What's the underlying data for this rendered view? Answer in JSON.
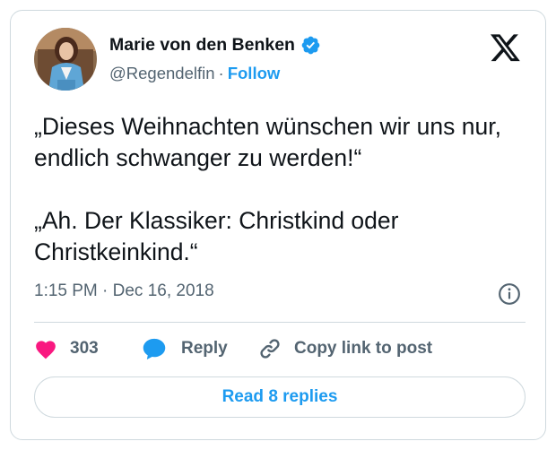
{
  "author": {
    "display_name": "Marie von den Benken",
    "handle": "@Regendelfin",
    "separator": "·",
    "follow_label": "Follow",
    "verified": true
  },
  "tweet": {
    "paragraph_1": "„Dieses Weihnachten wünschen wir uns nur, endlich schwanger zu werden!“",
    "paragraph_2": "„Ah. Der Klassiker: Christkind oder Christkeinkind.“",
    "timestamp": "1:15 PM · Dec 16, 2018"
  },
  "actions": {
    "like_count": "303",
    "reply_label": "Reply",
    "copy_link_label": "Copy link to post"
  },
  "footer": {
    "read_replies_label": "Read 8 replies"
  },
  "colors": {
    "accent": "#1d9bf0",
    "like": "#f91880",
    "text_primary": "#0f1419",
    "text_secondary": "#536471",
    "border": "#cfd9de"
  },
  "icons": {
    "brand": "x-logo-icon",
    "verified": "verified-badge-icon",
    "info": "info-icon",
    "like": "heart-icon",
    "reply": "speech-bubble-icon",
    "copy": "link-icon"
  }
}
